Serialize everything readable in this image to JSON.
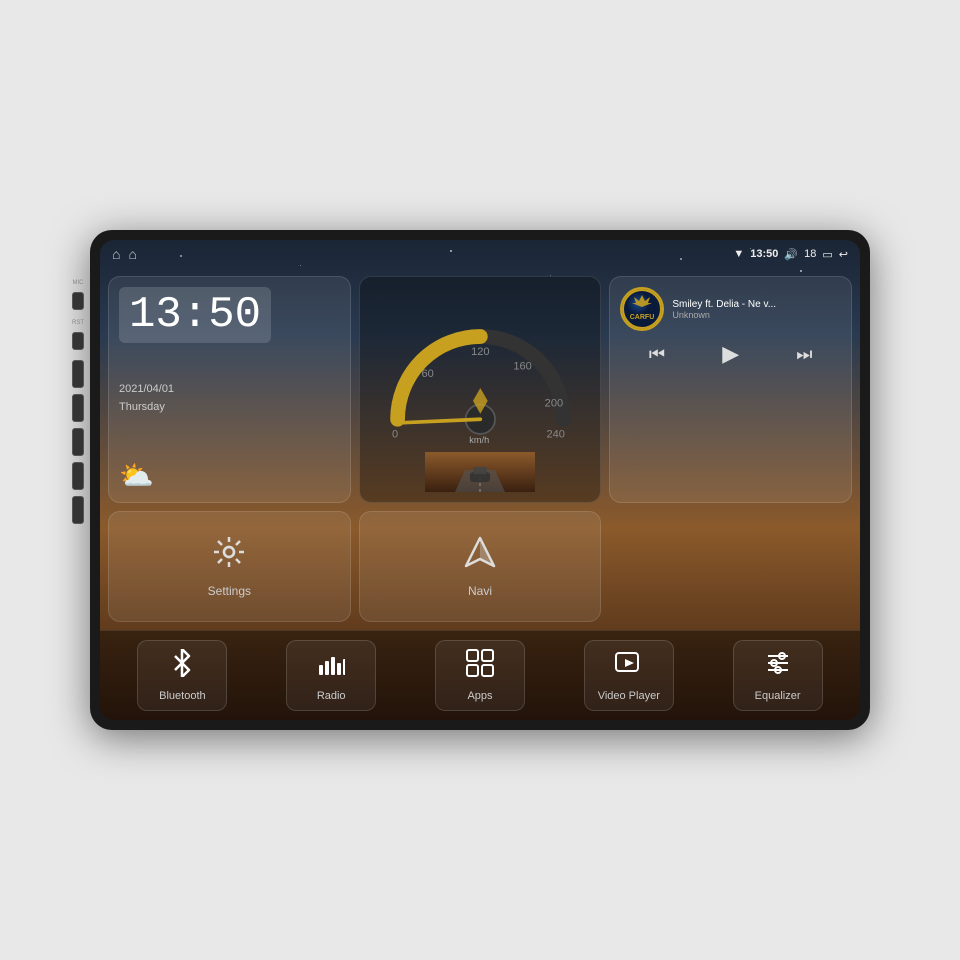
{
  "device": {
    "title": "Car Android Head Unit"
  },
  "statusBar": {
    "wifi_icon": "▼",
    "time": "13:50",
    "volume_icon": "🔊",
    "volume_level": "18",
    "window_icon": "▭",
    "back_icon": "↩",
    "home_icon": "⌂",
    "nav_icon": "⌂"
  },
  "clock": {
    "time": "13:50",
    "date": "2021/04/01",
    "day": "Thursday"
  },
  "music": {
    "logo": "CARFU",
    "title": "Smiley ft. Delia - Ne v...",
    "artist": "Unknown"
  },
  "speedo": {
    "label": "km/h",
    "value": "0"
  },
  "settings": {
    "label": "Settings"
  },
  "navi": {
    "label": "Navi"
  },
  "toolbar": [
    {
      "id": "bluetooth",
      "icon": "bluetooth",
      "label": "Bluetooth"
    },
    {
      "id": "radio",
      "icon": "radio",
      "label": "Radio"
    },
    {
      "id": "apps",
      "icon": "apps",
      "label": "Apps"
    },
    {
      "id": "video",
      "icon": "video",
      "label": "Video Player"
    },
    {
      "id": "equalizer",
      "icon": "eq",
      "label": "Equalizer"
    }
  ],
  "sideButtons": [
    {
      "id": "mic",
      "label": "MIC"
    },
    {
      "id": "rst",
      "label": "RST"
    },
    {
      "id": "power"
    },
    {
      "id": "home"
    },
    {
      "id": "return"
    },
    {
      "id": "vol-up"
    },
    {
      "id": "vol-down"
    }
  ]
}
